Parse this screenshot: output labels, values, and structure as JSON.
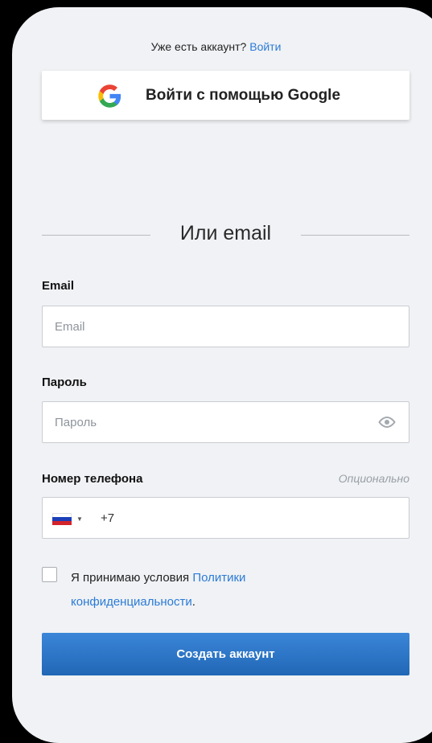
{
  "login": {
    "prompt": "Уже есть аккаунт?",
    "link": "Войти"
  },
  "google": {
    "label": "Войти с помощью Google",
    "icon": "google-icon"
  },
  "divider": {
    "text": "Или email"
  },
  "fields": {
    "email": {
      "label": "Email",
      "placeholder": "Email",
      "value": ""
    },
    "password": {
      "label": "Пароль",
      "placeholder": "Пароль",
      "value": "",
      "icon": "eye-icon"
    },
    "phone": {
      "label": "Номер телефона",
      "optional": "Опционально",
      "prefix": "+7",
      "country_flag": "russia-flag-icon"
    }
  },
  "terms": {
    "text": "Я принимаю условия ",
    "link": "Политики конфиденциальности",
    "suffix": ".",
    "checked": false
  },
  "submit": {
    "label": "Создать аккаунт"
  },
  "colors": {
    "accent": "#2c7bd6",
    "button": "#2a72c4",
    "background": "#f0f2f5"
  }
}
